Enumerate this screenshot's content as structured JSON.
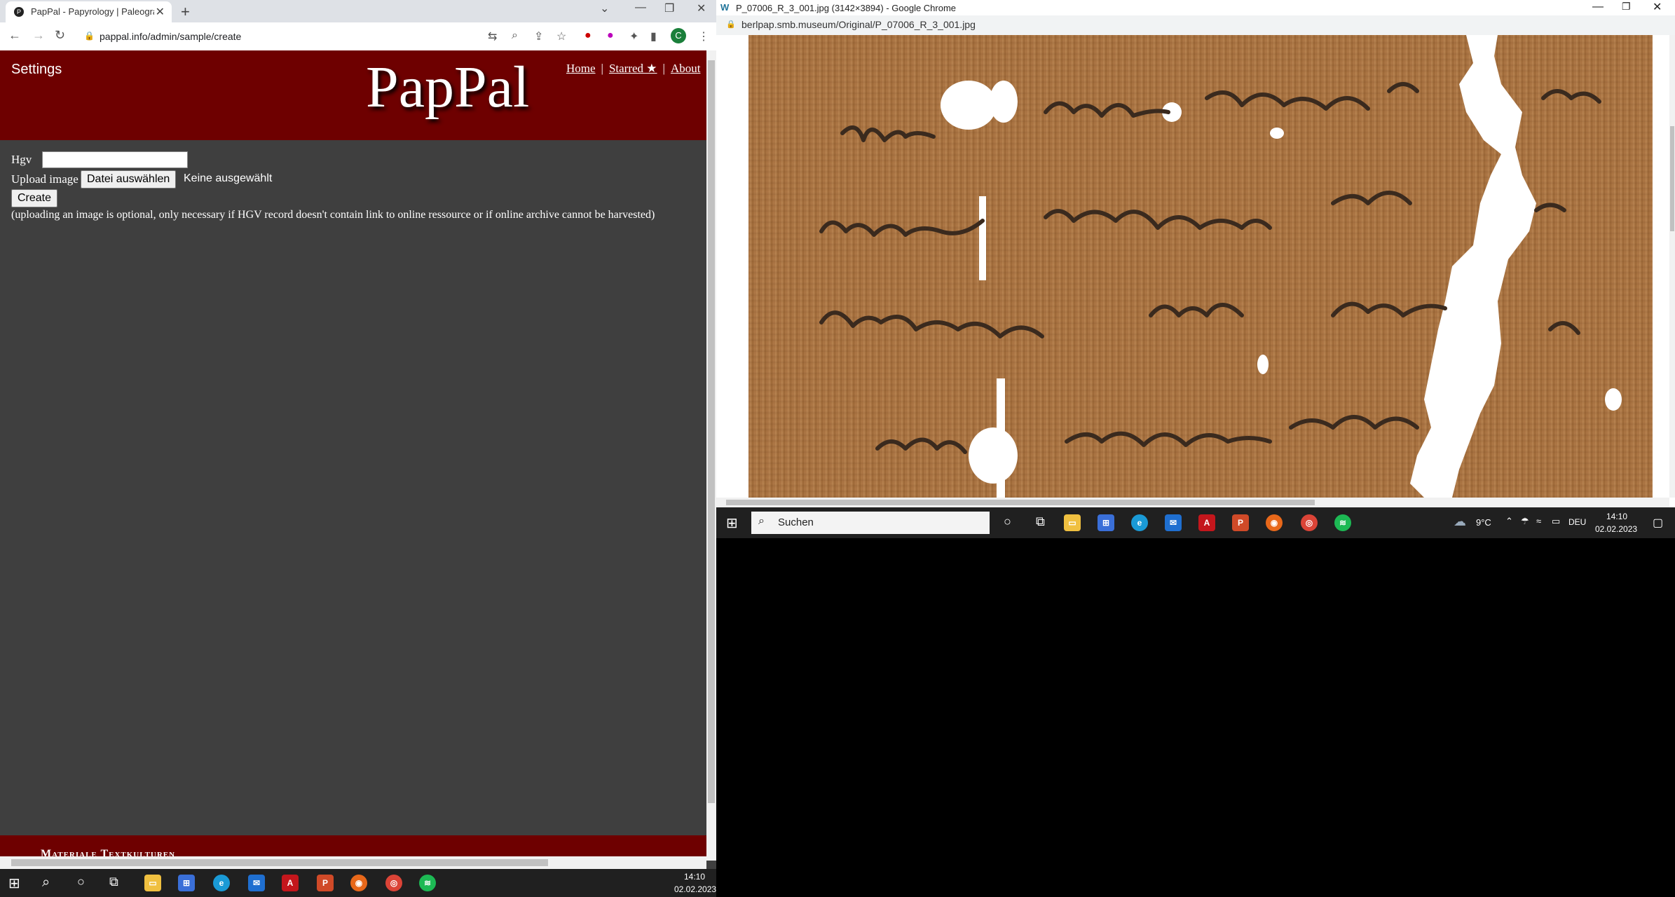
{
  "left_browser": {
    "tab_title": "PapPal - Papyrology | Paleograph",
    "url": "pappal.info/admin/sample/create",
    "profile_initial": "C",
    "site": {
      "settings_label": "Settings",
      "logo_text": "PapPal",
      "nav": {
        "home": "Home",
        "starred": "Starred ★",
        "about": "About"
      },
      "form": {
        "hgv_label": "Hgv",
        "hgv_value": "",
        "upload_label": "Upload image",
        "choose_file_button": "Datei auswählen",
        "no_file_text": "Keine ausgewählt",
        "create_button": "Create",
        "note": "(uploading an image is optional, only necessary if HGV record doesn't contain link to online ressource or if online archive cannot be harvested)"
      },
      "footer_text": "Materiale Textkulturen"
    }
  },
  "right_browser": {
    "window_title": "P_07006_R_3_001.jpg (3142×3894) - Google Chrome",
    "url": "berlpap.smb.museum/Original/P_07006_R_3_001.jpg"
  },
  "taskbar_right": {
    "search_placeholder": "Suchen",
    "weather": "9°C",
    "language": "DEU",
    "time": "14:10",
    "date": "02.02.2023"
  },
  "taskbar_left": {
    "time": "14:10",
    "date": "02.02.2023"
  }
}
